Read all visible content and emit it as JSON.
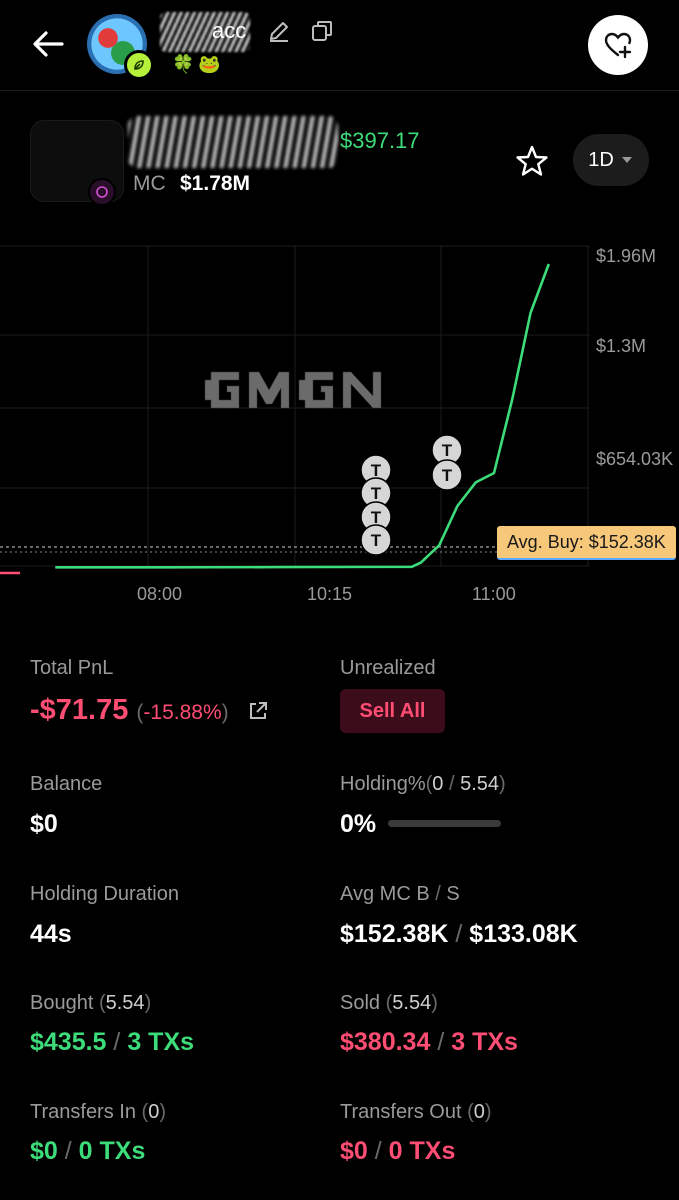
{
  "header": {
    "name_visible": "acc",
    "emojis": "🍀🐸"
  },
  "token": {
    "price": "$397.17",
    "mc_label": "MC",
    "mc_value": "$1.78M",
    "timeframe": "1D"
  },
  "chart_data": {
    "type": "line",
    "watermark": "GMGN",
    "x_ticks": [
      "08:00",
      "10:15",
      "11:00"
    ],
    "y_ticks": [
      "$1.96M",
      "$1.3M",
      "$654.03K"
    ],
    "series": [
      {
        "color": "#3ddc7a",
        "points": [
          {
            "x": "07:00",
            "y": 30000
          },
          {
            "x": "08:00",
            "y": 30000
          },
          {
            "x": "09:00",
            "y": 31000
          },
          {
            "x": "10:15",
            "y": 33000
          },
          {
            "x": "10:20",
            "y": 60000
          },
          {
            "x": "10:30",
            "y": 170000
          },
          {
            "x": "10:40",
            "y": 420000
          },
          {
            "x": "10:50",
            "y": 570000
          },
          {
            "x": "11:00",
            "y": 630000
          },
          {
            "x": "11:10",
            "y": 1100000
          },
          {
            "x": "11:20",
            "y": 1650000
          },
          {
            "x": "11:30",
            "y": 1960000
          }
        ]
      }
    ],
    "avg_buy_label": "Avg. Buy: $152.38K",
    "trade_markers": [
      "T",
      "T",
      "T",
      "T",
      "T",
      "T"
    ]
  },
  "stats": {
    "total_pnl_label": "Total PnL",
    "total_pnl_value": "-$71.75",
    "total_pnl_pct": "-15.88%",
    "unrealized_label": "Unrealized",
    "sell_all_label": "Sell All",
    "balance_label": "Balance",
    "balance_value": "$0",
    "holding_pct_label": "Holding%",
    "holding_a": "0",
    "holding_b": "5.54",
    "holding_pct_value": "0%",
    "holding_fill": 0,
    "duration_label": "Holding Duration",
    "duration_value": "44s",
    "avg_mc_label_b": "Avg MC B",
    "avg_mc_label_s": "S",
    "avg_mc_buy": "$152.38K",
    "avg_mc_sell": "$133.08K",
    "bought_label": "Bought",
    "bought_amt": "5.54",
    "bought_value": "$435.5",
    "bought_txs": "3 TXs",
    "sold_label": "Sold",
    "sold_amt": "5.54",
    "sold_value": "$380.34",
    "sold_txs": "3 TXs",
    "transfers_in_label": "Transfers In",
    "transfers_in_amt": "0",
    "transfers_in_value": "$0",
    "transfers_in_txs": "0 TXs",
    "transfers_out_label": "Transfers Out",
    "transfers_out_amt": "0",
    "transfers_out_value": "$0",
    "transfers_out_txs": "0 TXs"
  }
}
